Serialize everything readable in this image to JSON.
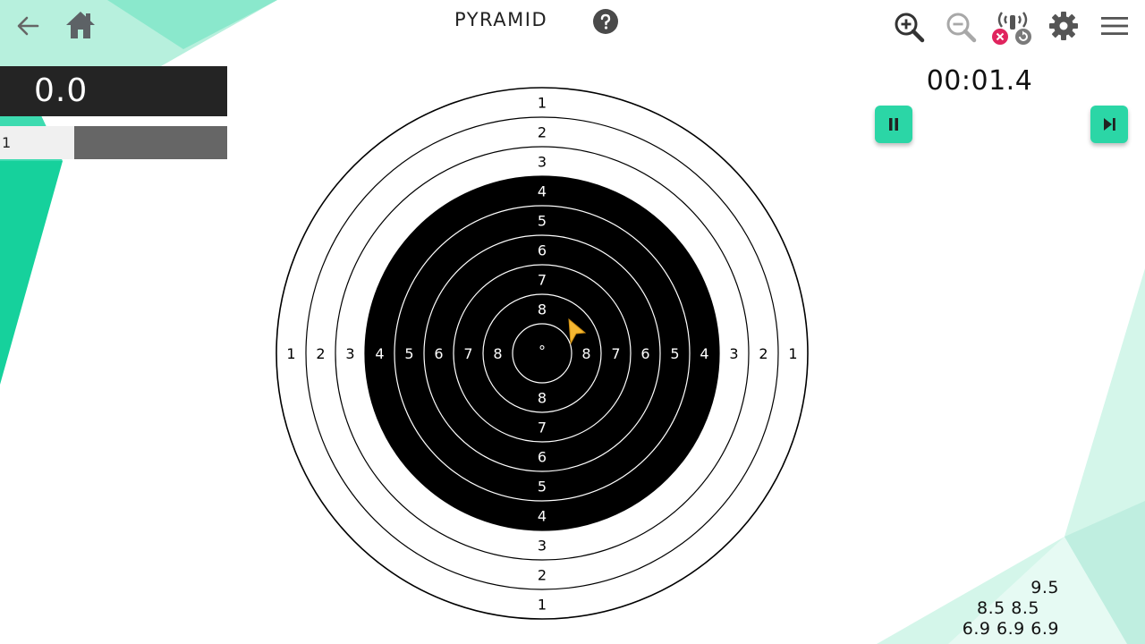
{
  "header": {
    "title": "PYRAMID",
    "icons": {
      "back": "arrow-left-icon",
      "home": "home-icon",
      "help": "help-circle-icon",
      "zoom_in": "zoom-in-icon",
      "zoom_out": "zoom-out-icon",
      "sensor": "sensor-disconnected-icon",
      "settings": "gear-icon",
      "menu": "hamburger-menu-icon"
    }
  },
  "score": {
    "total": "0.0",
    "shot_number": "1"
  },
  "timer": {
    "value": "00:01.4"
  },
  "controls": {
    "pause_icon": "pause-icon",
    "next_icon": "skip-next-icon"
  },
  "target": {
    "ring_labels": [
      "1",
      "2",
      "3",
      "4",
      "5",
      "6",
      "7",
      "8"
    ],
    "center_mark": "°"
  },
  "recent_scores": {
    "row1": "9.5",
    "row2": "8.5 8.5",
    "row3": "6.9 6.9 6.9"
  },
  "colors": {
    "accent": "#2bd6a6",
    "target_black": "#000000",
    "score_box": "#242424",
    "cursor": "#f5b731"
  }
}
